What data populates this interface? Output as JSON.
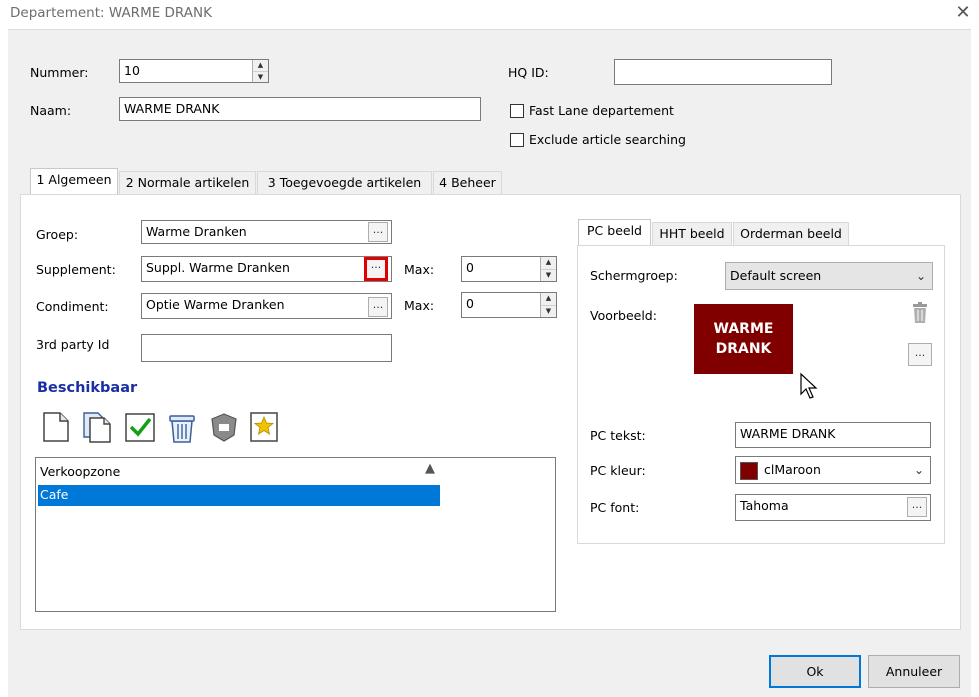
{
  "window": {
    "title": "Departement: WARME DRANK",
    "close_glyph": "✕"
  },
  "header": {
    "nummer_label": "Nummer:",
    "nummer_value": "10",
    "naam_label": "Naam:",
    "naam_value": "WARME DRANK",
    "hqid_label": "HQ ID:",
    "hqid_value": "",
    "fast_lane_label": "Fast Lane departement",
    "exclude_label": "Exclude article searching"
  },
  "tabs": [
    {
      "label": "1 Algemeen"
    },
    {
      "label": "2 Normale artikelen"
    },
    {
      "label": "3 Toegevoegde artikelen"
    },
    {
      "label": "4 Beheer"
    }
  ],
  "general": {
    "groep_label": "Groep:",
    "groep_value": "Warme Dranken",
    "supplement_label": "Supplement:",
    "supplement_value": "Suppl. Warme Dranken",
    "condiment_label": "Condiment:",
    "condiment_value": "Optie Warme Dranken",
    "max_label": "Max:",
    "supplement_max": "0",
    "condiment_max": "0",
    "third_party_label": "3rd party Id",
    "third_party_value": "",
    "dots": "..."
  },
  "beschikbaar": {
    "title": "Beschikbaar",
    "column_header": "Verkoopzone",
    "rows": [
      "Cafe"
    ],
    "toolbar_icons": [
      "new-document-icon",
      "copy-document-icon",
      "check-icon",
      "trash-icon",
      "shield-icon",
      "star-document-icon"
    ]
  },
  "visual_tabs": [
    {
      "label": "PC beeld"
    },
    {
      "label": "HHT beeld"
    },
    {
      "label": "Orderman beeld"
    }
  ],
  "pc_beeld": {
    "schermgroep_label": "Schermgroep:",
    "schermgroep_value": "Default screen",
    "voorbeeld_label": "Voorbeeld:",
    "preview_line1": "WARME",
    "preview_line2": "DRANK",
    "pc_tekst_label": "PC tekst:",
    "pc_tekst_value": "WARME DRANK",
    "pc_kleur_label": "PC kleur:",
    "pc_kleur_value": "clMaroon",
    "pc_kleur_color": "#800000",
    "pc_font_label": "PC font:",
    "pc_font_value": "Tahoma"
  },
  "buttons": {
    "ok": "Ok",
    "cancel": "Annuleer"
  },
  "colors": {
    "selection": "#0078d7",
    "accent_border": "#0078d7",
    "highlight": "#e30000",
    "preview_bg": "#800000"
  }
}
